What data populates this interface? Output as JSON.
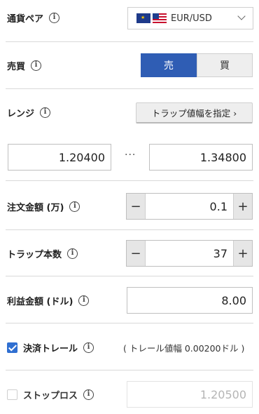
{
  "currency_pair": {
    "label": "通貨ペア",
    "value": "EUR/USD"
  },
  "side": {
    "label": "売買",
    "sell": "売",
    "buy": "買"
  },
  "range": {
    "label": "レンジ",
    "button": "トラップ値幅を指定 ›",
    "low": "1.20400",
    "separator": "···",
    "high": "1.34800"
  },
  "order_amount": {
    "label": "注文金額 (万)",
    "value": "0.1",
    "minus": "−",
    "plus": "+"
  },
  "trap_count": {
    "label": "トラップ本数",
    "value": "37",
    "minus": "−",
    "plus": "+"
  },
  "profit_amount": {
    "label": "利益金額 (ドル)",
    "value": "8.00"
  },
  "trailing": {
    "label": "決済トレール",
    "checked": true,
    "note": "( トレール値幅 0.00200ドル )"
  },
  "stop_loss": {
    "label": "ストップロス",
    "checked": false,
    "value": "1.20500"
  },
  "info_glyph": "i",
  "colors": {
    "accent": "#2f5db4",
    "checkbox": "#2f6fd1",
    "divider": "#d9d9d9"
  }
}
